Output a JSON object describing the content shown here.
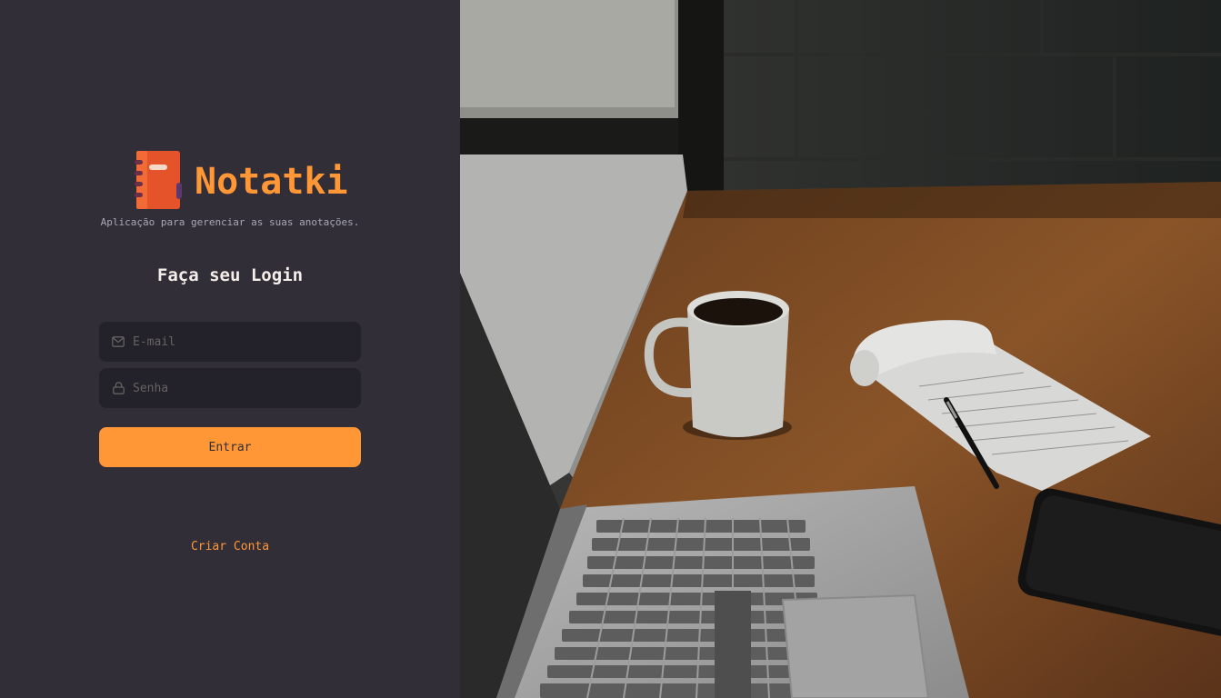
{
  "brand": {
    "title": "Notatki",
    "tagline": "Aplicação para gerenciar as suas anotações.",
    "logo_icon": "notebook-icon"
  },
  "login": {
    "heading": "Faça seu Login",
    "email_placeholder": "E-mail",
    "email_value": "",
    "email_icon": "mail-icon",
    "password_placeholder": "Senha",
    "password_value": "",
    "password_icon": "lock-icon",
    "submit_label": "Entrar",
    "create_account_label": "Criar Conta"
  },
  "colors": {
    "background": "#312e38",
    "input_background": "#232129",
    "accent": "#ff9737",
    "text": "#f4ede8",
    "muted": "#a8a8b3",
    "placeholder": "#666360"
  },
  "hero_image": {
    "subject": "desk-with-laptop-coffee-notebook"
  }
}
